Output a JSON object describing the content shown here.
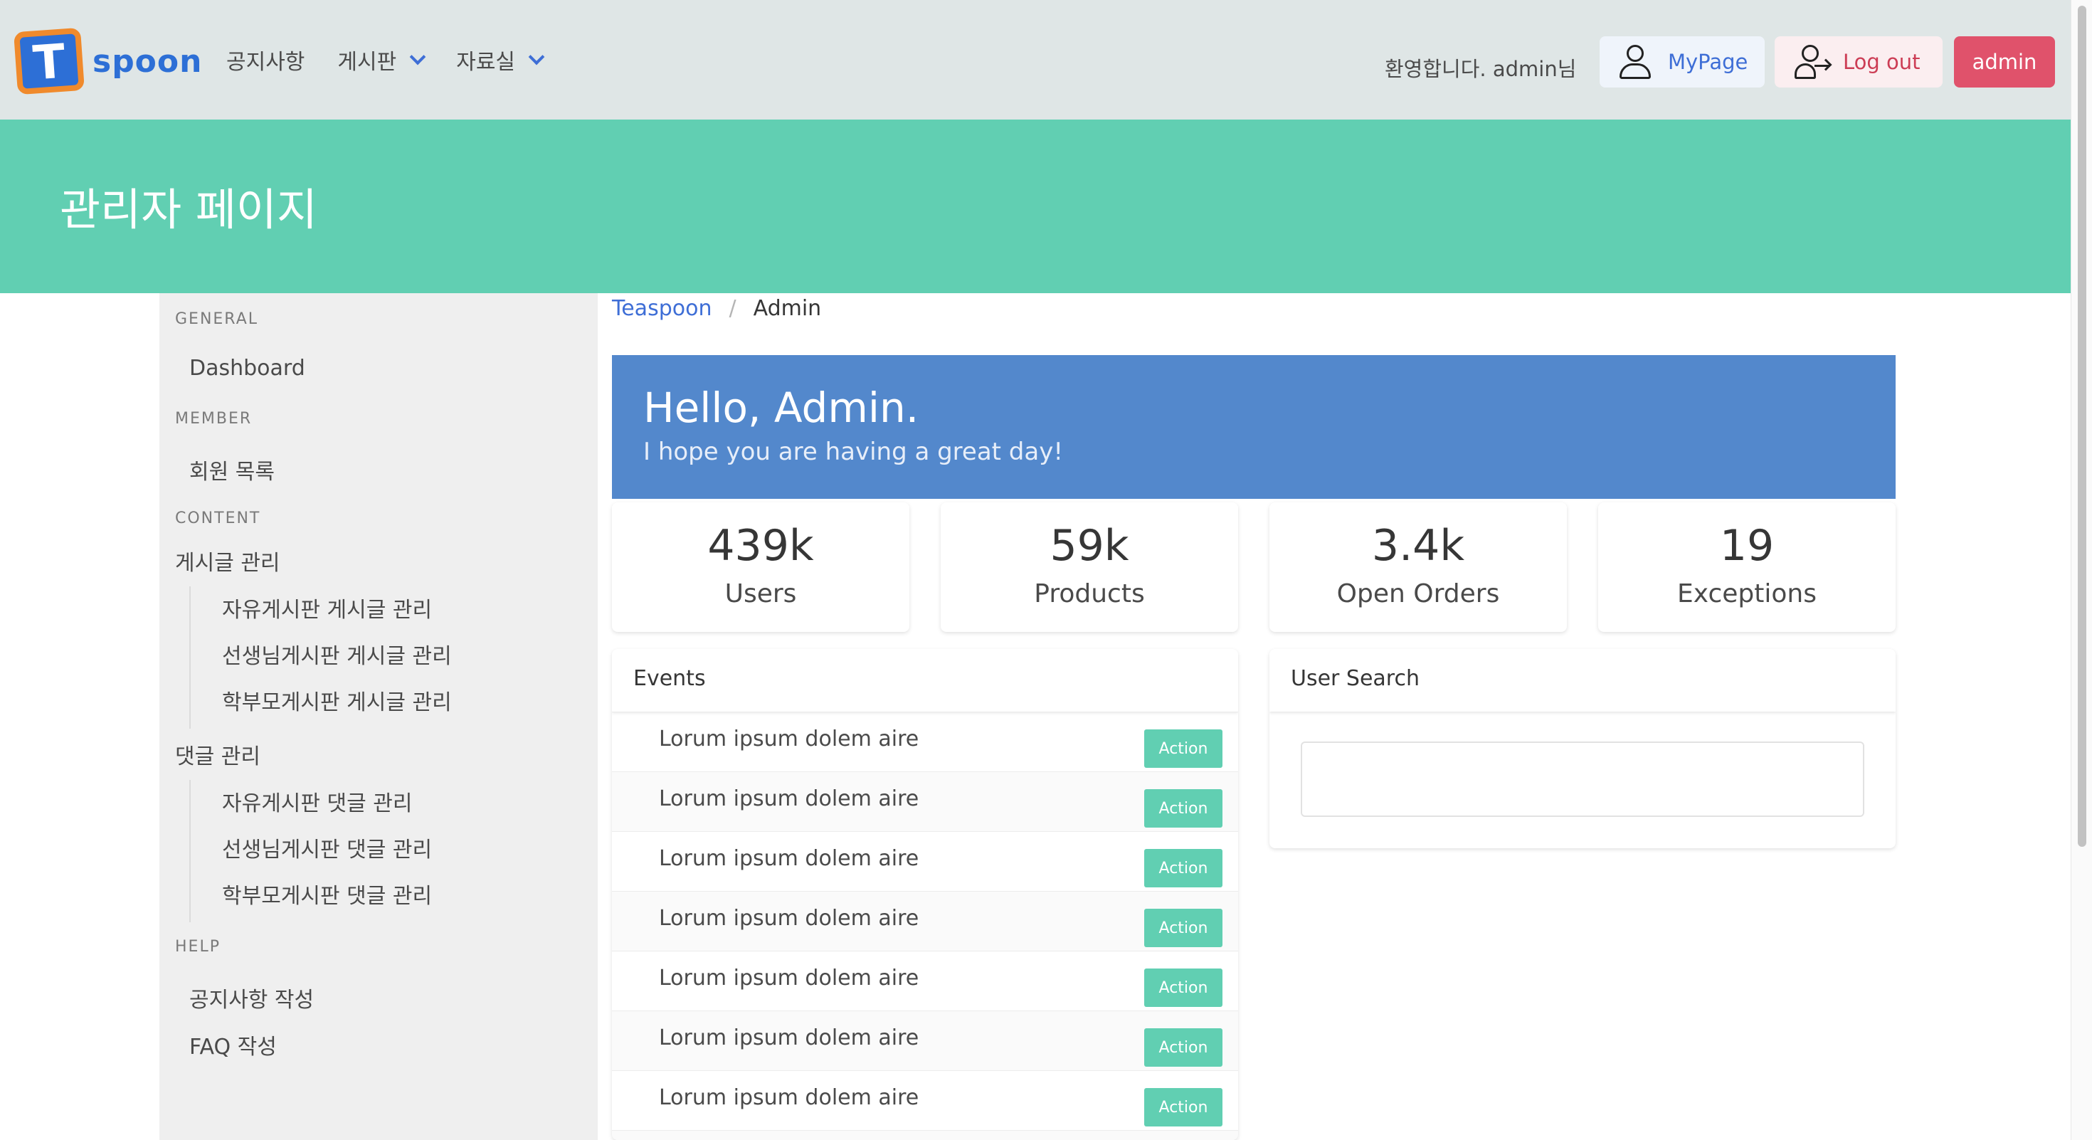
{
  "navbar": {
    "logo_letter": "T",
    "logo_text": "spoon",
    "menu": [
      {
        "label": "공지사항",
        "dropdown": false
      },
      {
        "label": "게시판",
        "dropdown": true
      },
      {
        "label": "자료실",
        "dropdown": true
      }
    ],
    "welcome": "환영합니다. admin님",
    "mypage_label": "MyPage",
    "logout_label": "Log out",
    "admin_label": "admin"
  },
  "hero": {
    "title": "관리자 페이지"
  },
  "sidebar": {
    "general_label": "GENERAL",
    "dashboard": "Dashboard",
    "member_label": "MEMBER",
    "member_list": "회원 목록",
    "content_label": "CONTENT",
    "post_manage": "게시글 관리",
    "post_items": [
      "자유게시판 게시글 관리",
      "선생님게시판 게시글 관리",
      "학부모게시판 게시글 관리"
    ],
    "comment_manage": "댓글 관리",
    "comment_items": [
      "자유게시판 댓글 관리",
      "선생님게시판 댓글 관리",
      "학부모게시판 댓글 관리"
    ],
    "help_label": "HELP",
    "notice_write": "공지사항 작성",
    "faq_write": "FAQ 작성"
  },
  "breadcrumb": {
    "root": "Teaspoon",
    "separator": "/",
    "current": "Admin"
  },
  "hello": {
    "title": "Hello, Admin.",
    "subtitle": "I hope you are having a great day!"
  },
  "stats": [
    {
      "value": "439k",
      "label": "Users"
    },
    {
      "value": "59k",
      "label": "Products"
    },
    {
      "value": "3.4k",
      "label": "Open Orders"
    },
    {
      "value": "19",
      "label": "Exceptions"
    }
  ],
  "events": {
    "title": "Events",
    "rows": [
      {
        "text": "Lorum ipsum dolem aire",
        "action": "Action"
      },
      {
        "text": "Lorum ipsum dolem aire",
        "action": "Action"
      },
      {
        "text": "Lorum ipsum dolem aire",
        "action": "Action"
      },
      {
        "text": "Lorum ipsum dolem aire",
        "action": "Action"
      },
      {
        "text": "Lorum ipsum dolem aire",
        "action": "Action"
      },
      {
        "text": "Lorum ipsum dolem aire",
        "action": "Action"
      },
      {
        "text": "Lorum ipsum dolem aire",
        "action": "Action"
      }
    ]
  },
  "user_search": {
    "title": "User Search",
    "value": ""
  },
  "colors": {
    "accent": "#61cfb2",
    "primary": "#3e6ed6",
    "hello_bg": "#5388cc",
    "danger": "#e0526b"
  }
}
